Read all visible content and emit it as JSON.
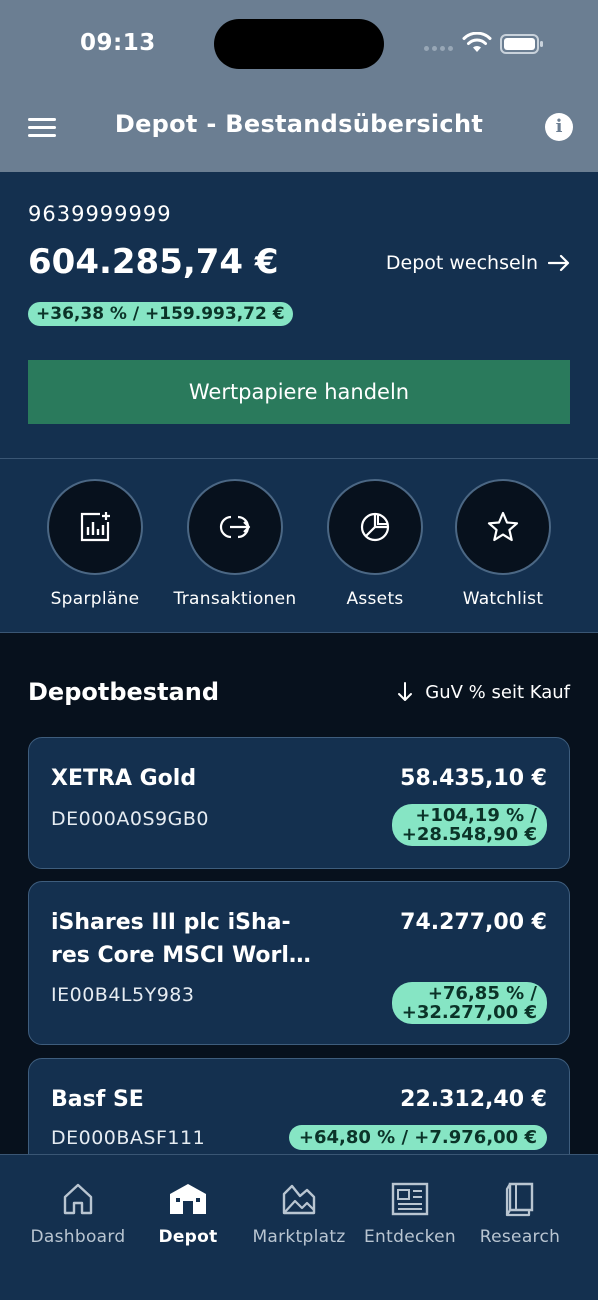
{
  "status": {
    "time": "09:13"
  },
  "header": {
    "title": "Depot - Bestandsübersicht"
  },
  "summary": {
    "account_number": "9639999999",
    "total_value": "604.285,74 €",
    "switch_label": "Depot wechseln",
    "performance": "+36,38 % / +159.993,72 €",
    "trade_button": "Wertpapiere handeln"
  },
  "actions": [
    {
      "label": "Sparpläne",
      "icon": "savings-plan-chart-icon"
    },
    {
      "label": "Transaktionen",
      "icon": "transactions-icon"
    },
    {
      "label": "Assets",
      "icon": "pie-chart-icon"
    },
    {
      "label": "Watchlist",
      "icon": "star-icon"
    }
  ],
  "holdings_section": {
    "title": "Depotbestand",
    "sort_label": "GuV % seit Kauf"
  },
  "holdings": [
    {
      "name": "XETRA Gold",
      "value": "58.435,10 €",
      "isin": "DE000A0S9GB0",
      "gain_pct": "+104,19 % /",
      "gain_abs": "+28.548,90 €"
    },
    {
      "name_line1": "iShares III plc iSha-",
      "name_line2": "res Core MSCI Worl…",
      "value": "74.277,00 €",
      "isin": "IE00B4L5Y983",
      "gain_pct": "+76,85 % /",
      "gain_abs": "+32.277,00 €"
    },
    {
      "name": "Basf SE",
      "value": "22.312,40 €",
      "isin": "DE000BASF111",
      "gain": "+64,80 % / +7.976,00 €"
    }
  ],
  "nav": [
    {
      "label": "Dashboard",
      "icon": "home-icon"
    },
    {
      "label": "Depot",
      "icon": "depot-icon",
      "active": true
    },
    {
      "label": "Marktplatz",
      "icon": "marketplace-icon"
    },
    {
      "label": "Entdecken",
      "icon": "newspaper-icon"
    },
    {
      "label": "Research",
      "icon": "book-icon"
    }
  ],
  "colors": {
    "header_bg": "#6b7e92",
    "panel_bg": "#14304f",
    "page_bg": "#07111d",
    "accent_green": "#2a7a5c",
    "gain_pill": "#86e5c4"
  }
}
